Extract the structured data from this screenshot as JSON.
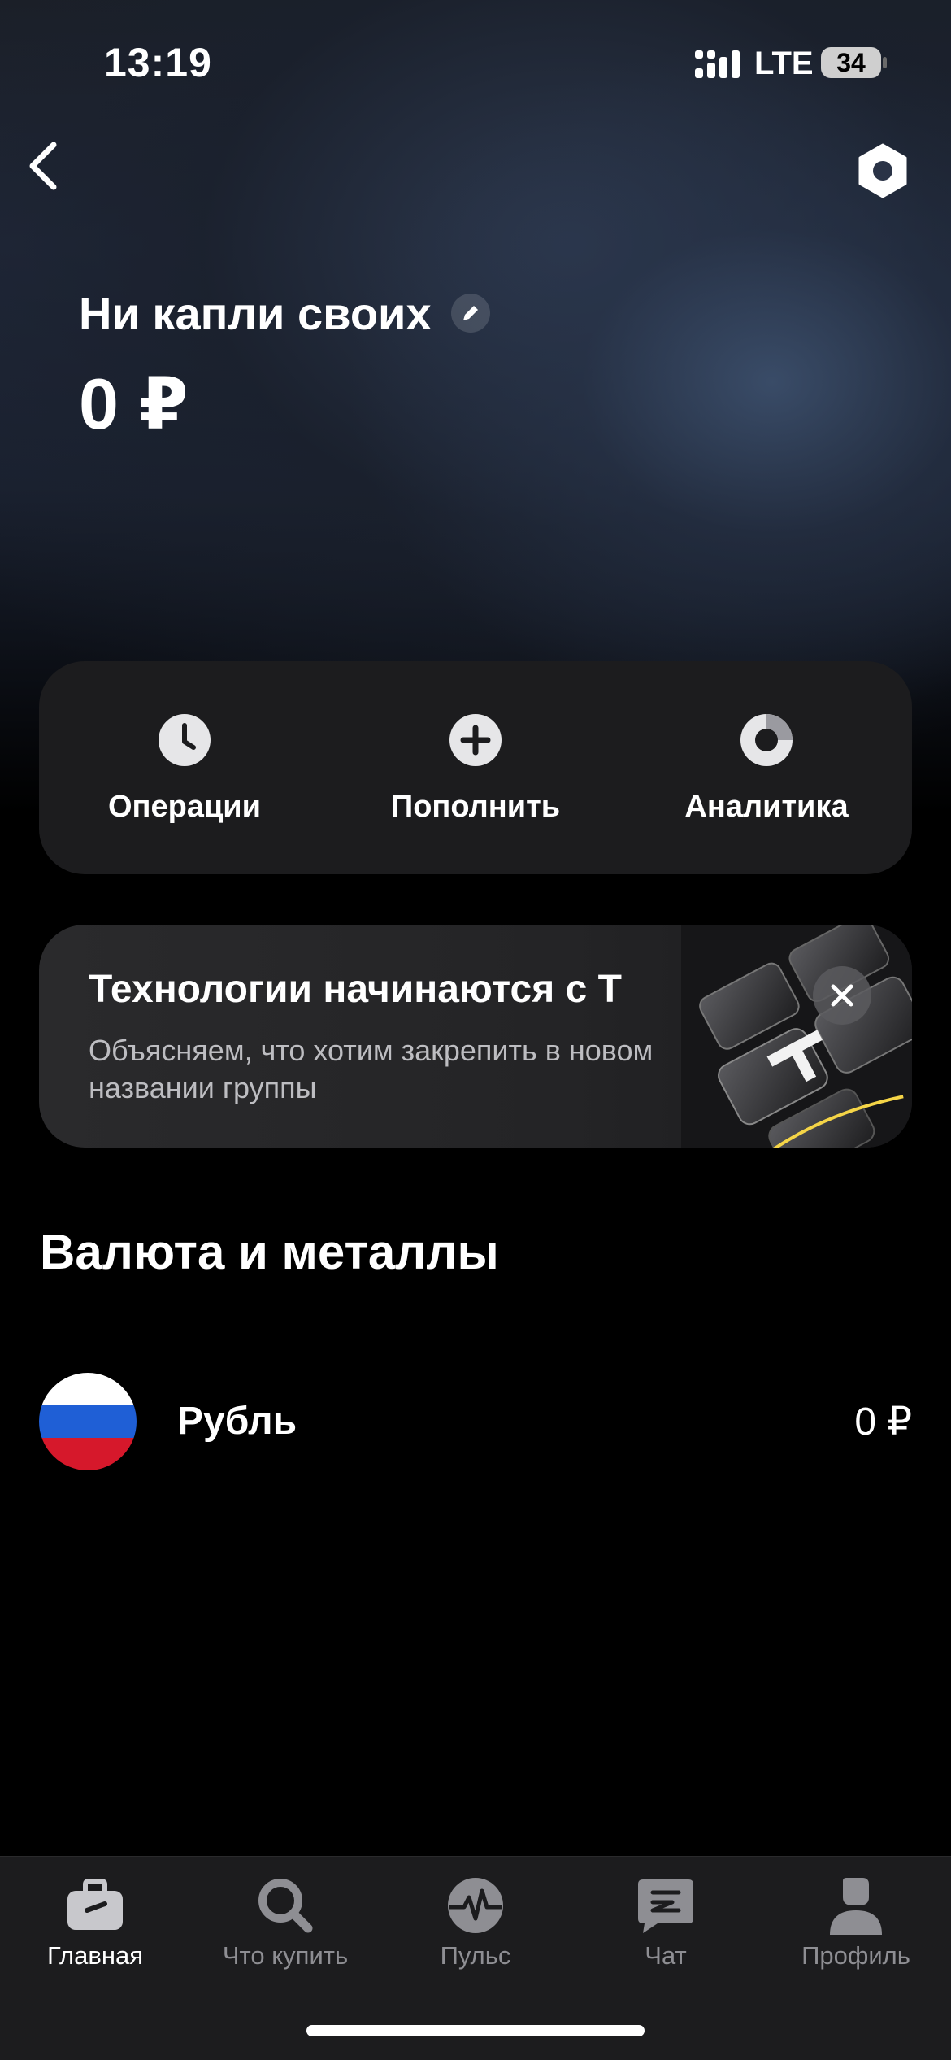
{
  "status_bar": {
    "time": "13:19",
    "network": "LTE",
    "battery": "34"
  },
  "header": {
    "back_icon": "chevron-left-icon",
    "settings_icon": "hexagon-settings-icon"
  },
  "account": {
    "title": "Ни капли своих",
    "balance": "0 ₽"
  },
  "actions": [
    {
      "label": "Операции",
      "icon": "clock-icon"
    },
    {
      "label": "Пополнить",
      "icon": "plus-icon"
    },
    {
      "label": "Аналитика",
      "icon": "donut-chart-icon"
    }
  ],
  "promo": {
    "title": "Технологии начинаются с Т",
    "text": "Объясняем, что хотим закрепить в новом названии группы",
    "accent_color": "#f5d547"
  },
  "section": {
    "title": "Валюта и металлы"
  },
  "currencies": [
    {
      "name": "Рубль",
      "amount": "0 ₽",
      "flag_colors": [
        "#ffffff",
        "#1f5fd6",
        "#d6182b"
      ]
    }
  ],
  "tabs": [
    {
      "label": "Главная",
      "icon": "briefcase-icon",
      "active": true
    },
    {
      "label": "Что купить",
      "icon": "search-icon",
      "active": false
    },
    {
      "label": "Пульс",
      "icon": "pulse-icon",
      "active": false
    },
    {
      "label": "Чат",
      "icon": "chat-icon",
      "active": false
    },
    {
      "label": "Профиль",
      "icon": "profile-icon",
      "active": false
    }
  ]
}
